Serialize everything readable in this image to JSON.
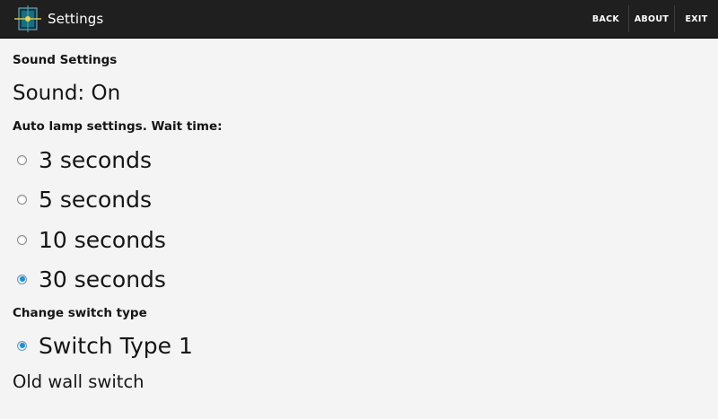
{
  "actionbar": {
    "app_icon": "lamp-app-icon",
    "title": "Settings",
    "actions": {
      "back": "BACK",
      "about": "ABOUT",
      "exit": "EXIT"
    },
    "background": "#1f1f1f"
  },
  "sound": {
    "header": "Sound Settings",
    "status": "Sound: On"
  },
  "auto_lamp": {
    "header": "Auto lamp settings. Wait time:",
    "options": [
      {
        "label": "3 seconds",
        "checked": false
      },
      {
        "label": "5 seconds",
        "checked": false
      },
      {
        "label": "10 seconds",
        "checked": false
      },
      {
        "label": "30 seconds",
        "checked": true
      }
    ]
  },
  "switch_type": {
    "header": "Change switch type",
    "options": [
      {
        "label": "Switch Type 1",
        "checked": true
      }
    ],
    "description": "Old wall switch"
  },
  "colors": {
    "accent": "#1e8fd1",
    "page_background": "#f4f4f4"
  }
}
